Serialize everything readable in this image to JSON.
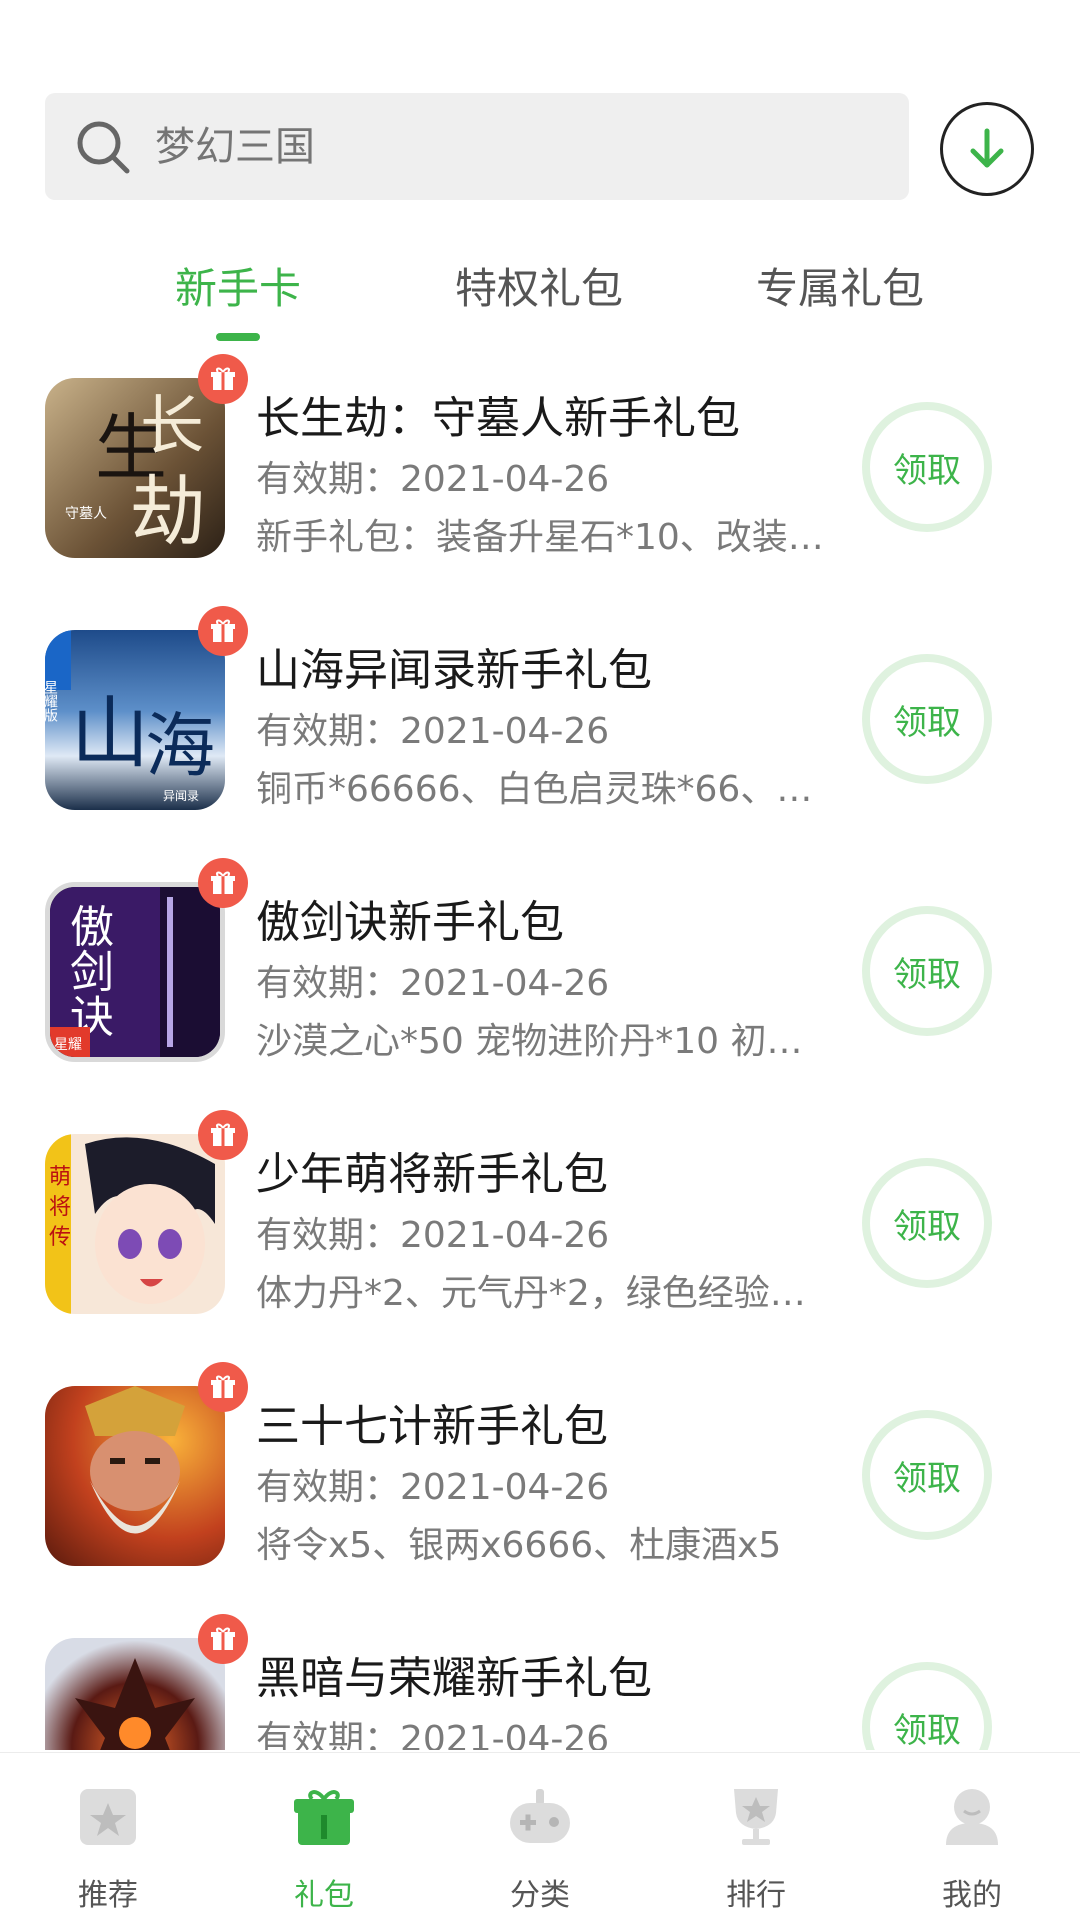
{
  "search": {
    "placeholder": "梦幻三国"
  },
  "tabs": [
    {
      "label": "新手卡",
      "active": true
    },
    {
      "label": "特权礼包",
      "active": false
    },
    {
      "label": "专属礼包",
      "active": false
    }
  ],
  "gifts": [
    {
      "title": "长生劫：守墓人新手礼包",
      "validity": "有效期：2021-04-26",
      "desc": "新手礼包：装备升星石*10、改装…",
      "claim": "领取"
    },
    {
      "title": "山海异闻录新手礼包",
      "validity": "有效期：2021-04-26",
      "desc": "铜币*66666、白色启灵珠*66、2…",
      "claim": "领取"
    },
    {
      "title": "傲剑诀新手礼包",
      "validity": "有效期：2021-04-26",
      "desc": "沙漠之心*50 宠物进阶丹*10 初…",
      "claim": "领取"
    },
    {
      "title": "少年萌将新手礼包",
      "validity": "有效期：2021-04-26",
      "desc": "体力丹*2、元气丹*2，绿色经验…",
      "claim": "领取"
    },
    {
      "title": "三十七计新手礼包",
      "validity": "有效期：2021-04-26",
      "desc": "将令x5、银两x6666、杜康酒x5",
      "claim": "领取"
    },
    {
      "title": "黑暗与荣耀新手礼包",
      "validity": "有效期：2021-04-26",
      "desc": "",
      "claim": "领取"
    }
  ],
  "thumbnail_art": {
    "0": [
      "长",
      "生",
      "劫",
      "守墓人"
    ],
    "1": [
      "星耀版",
      "山",
      "海",
      "异闻录"
    ],
    "2": [
      "傲",
      "剑",
      "诀",
      "星耀"
    ],
    "3": [
      "萌",
      "将",
      "传"
    ]
  },
  "bottom_nav": [
    {
      "label": "推荐",
      "icon": "star-box-icon",
      "active": false
    },
    {
      "label": "礼包",
      "icon": "gift-icon",
      "active": true
    },
    {
      "label": "分类",
      "icon": "gamepad-icon",
      "active": false
    },
    {
      "label": "排行",
      "icon": "trophy-icon",
      "active": false
    },
    {
      "label": "我的",
      "icon": "user-icon",
      "active": false
    }
  ],
  "colors": {
    "accent": "#3db44a",
    "badge": "#f05a4a",
    "claim_ring": "#dff2df"
  }
}
